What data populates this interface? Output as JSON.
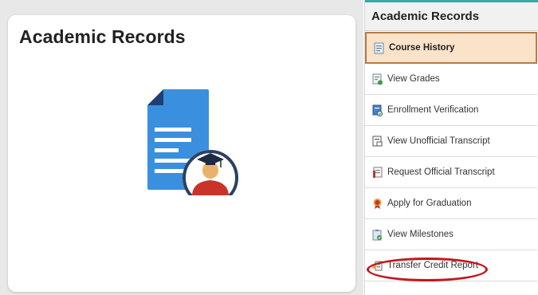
{
  "tile": {
    "title": "Academic Records"
  },
  "panel": {
    "header": "Academic Records",
    "items": [
      {
        "label": "Course History",
        "icon": "course-history-icon",
        "active": true
      },
      {
        "label": "View Grades",
        "icon": "view-grades-icon",
        "active": false
      },
      {
        "label": "Enrollment Verification",
        "icon": "enrollment-verification-icon",
        "active": false
      },
      {
        "label": "View Unofficial Transcript",
        "icon": "unofficial-transcript-icon",
        "active": false
      },
      {
        "label": "Request Official Transcript",
        "icon": "official-transcript-icon",
        "active": false
      },
      {
        "label": "Apply for Graduation",
        "icon": "graduation-icon",
        "active": false
      },
      {
        "label": "View Milestones",
        "icon": "milestones-icon",
        "active": false
      },
      {
        "label": "Transfer Credit Report",
        "icon": "transfer-credit-icon",
        "active": false
      }
    ]
  },
  "colors": {
    "accent": "#3aa9a5",
    "active_bg": "#fbe3c9",
    "active_border": "#b57a46",
    "highlight": "#c4161c",
    "doc_blue": "#3a8fde"
  }
}
